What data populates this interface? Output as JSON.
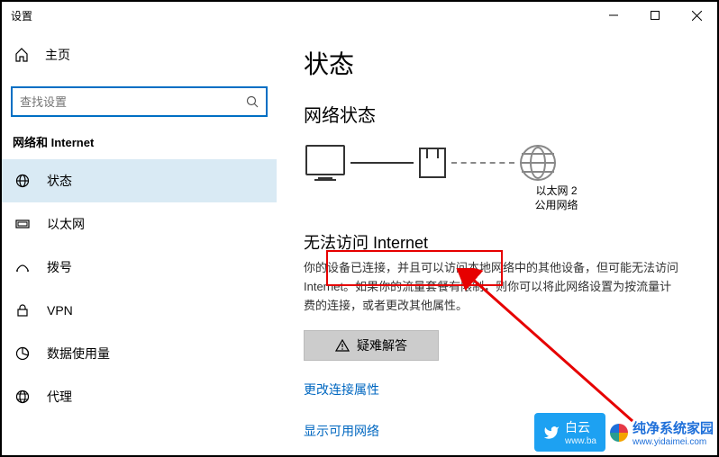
{
  "window": {
    "title": "设置"
  },
  "sidebar": {
    "home": "主页",
    "search_placeholder": "查找设置",
    "section": "网络和 Internet",
    "items": [
      {
        "label": "状态"
      },
      {
        "label": "以太网"
      },
      {
        "label": "拨号"
      },
      {
        "label": "VPN"
      },
      {
        "label": "数据使用量"
      },
      {
        "label": "代理"
      }
    ]
  },
  "main": {
    "title": "状态",
    "subtitle": "网络状态",
    "router_name": "以太网 2",
    "router_type": "公用网络",
    "warn_title": "无法访问 Internet",
    "warn_desc": "你的设备已连接，并且可以访问本地网络中的其他设备，但可能无法访问 Internet。如果你的流量套餐有限制，则你可以将此网络设置为按流量计费的连接，或者更改其他属性。",
    "troubleshoot": "疑难解答",
    "link1": "更改连接属性",
    "link2": "显示可用网络"
  },
  "badges": {
    "b1_main": "白云",
    "b1_sub": "www.ba",
    "b2_main": "纯净系统家园",
    "b2_sub": "www.yidaimei.com"
  }
}
